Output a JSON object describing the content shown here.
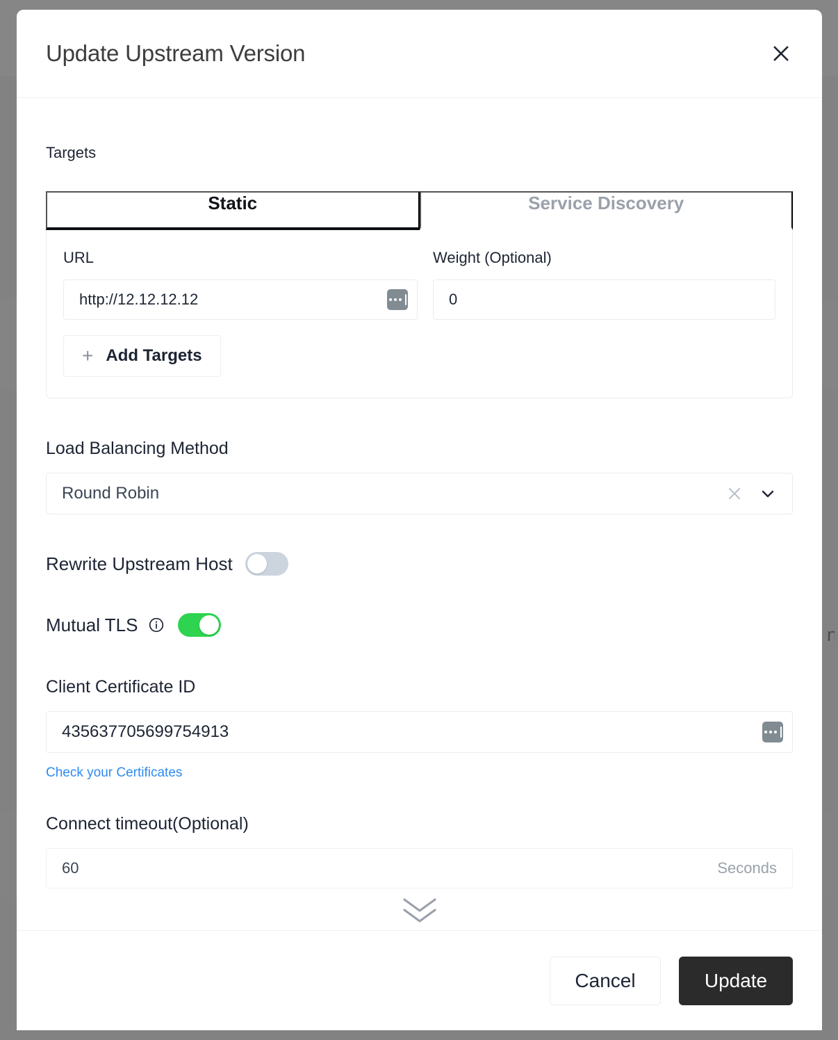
{
  "backdrop": {
    "overlay_color": "#828282",
    "ghost_text": "n"
  },
  "dialog": {
    "title": "Update Upstream Version",
    "close_icon": "close-icon"
  },
  "targets": {
    "section_label": "Targets",
    "tabs": [
      {
        "label": "Static",
        "active": true
      },
      {
        "label": "Service Discovery",
        "active": false
      }
    ],
    "columns": {
      "url_label": "URL",
      "weight_label": "Weight (Optional)"
    },
    "rows": [
      {
        "url_value": "http://12.12.12.12",
        "url_placeholder": "http://",
        "weight_value": "0",
        "weight_placeholder": "0",
        "url_badge_icon": "dots-badge-icon"
      }
    ],
    "add_button": {
      "label": "Add Targets",
      "icon": "plus-icon"
    }
  },
  "load_balancing": {
    "label": "Load Balancing Method",
    "selected": "Round Robin",
    "clear_icon": "clear-x-icon",
    "chevron_icon": "chevron-down-icon"
  },
  "rewrite_upstream_host": {
    "label": "Rewrite Upstream Host",
    "enabled": false,
    "state_text": "off"
  },
  "mutual_tls": {
    "label": "Mutual TLS",
    "info_icon": "info-circle-icon",
    "enabled": true,
    "state_text": "on"
  },
  "client_certificate": {
    "label": "Client Certificate ID",
    "value": "435637705699754913",
    "placeholder": "Client Certificate ID",
    "badge_icon": "dots-badge-icon",
    "help_link": "Check your Certificates"
  },
  "connect_timeout": {
    "label": "Connect timeout(Optional)",
    "value": "60",
    "suffix": "Seconds"
  },
  "scroll_hint": {
    "icon": "double-chevron-down-icon"
  },
  "footer": {
    "cancel_label": "Cancel",
    "update_label": "Update"
  },
  "colors": {
    "accent_green": "#2ed44f",
    "link_blue": "#2e8bf0",
    "primary_button": "#2b2b2b",
    "toggle_off": "#ccd4de",
    "tab_active_underline": "#0b0e12"
  }
}
